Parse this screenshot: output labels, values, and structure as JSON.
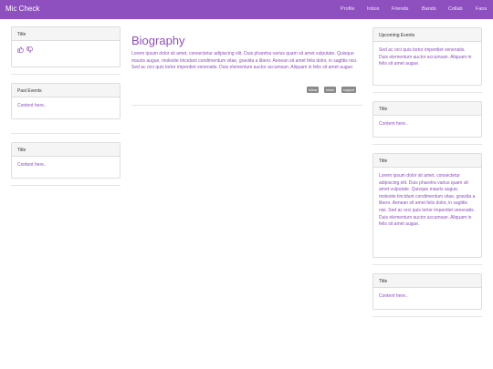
{
  "navbar": {
    "brand": "Mic Check",
    "items": [
      "Profile",
      "Inbox",
      "Friends",
      "Bands",
      "Collab",
      "Fans"
    ]
  },
  "left": {
    "panel1": {
      "title": "Title"
    },
    "panel2": {
      "title": "Past Events",
      "body": "Content here.."
    },
    "panel3": {
      "title": "Title",
      "body": "Content here.."
    }
  },
  "main": {
    "title": "Biography",
    "text": "Lorem ipsum dolor sit amet, consectetur adipiscing elit. Duis pharetra varius quam sit amet vulputate. Quisque mauris augue, molestie tincidunt condimentum vitae, gravida a libero. Aenean sit amet felis dolor, in sagittis nisi. Sed ac orci quis tortor imperdiet venenatis. Duis elementum auctor accumsan. Aliquam in felis sit amet augue.",
    "tags": [
      "follow",
      "share",
      "support"
    ]
  },
  "right": {
    "panel1": {
      "title": "Upcoming Events",
      "body": "Sed ac orci quis tortor imperdiet venenatis. Duis elementum auctor accumsan. Aliquam in felis sit amet augue."
    },
    "panel2": {
      "title": "Title",
      "body": "Content here.."
    },
    "panel3": {
      "title": "Title",
      "body": "Lorem ipsum dolor sit amet, consectetur adipiscing elit. Duis pharetra varius quam sit amet vulputate. Quisque mauris augue, molestie tincidunt condimentum vitae, gravida a libero. Aenean sit amet felis dolor, in sagittis nisi. Sed ac orci quis tortor imperdiet venenatis. Duis elementum auctor accumsan. Aliquam in felis sit amet augue."
    },
    "panel4": {
      "title": "Title",
      "body": "Content here.."
    }
  },
  "colors": {
    "accent": "#8e4fbf",
    "panel_heading": "#f5f5f5"
  }
}
